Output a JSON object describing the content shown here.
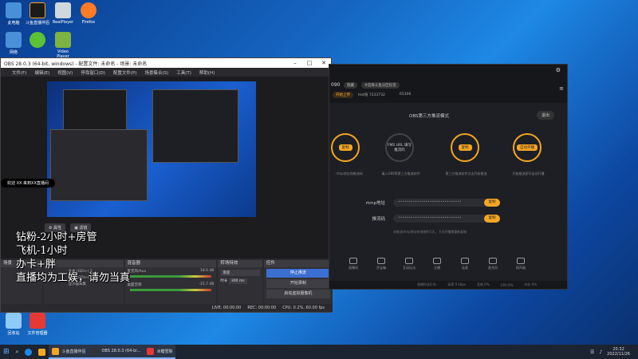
{
  "desktop": {
    "icons": [
      {
        "label": "此电脑",
        "color": "#4a90d9"
      },
      {
        "label": "斗鱼直播伴侣",
        "color": "#1b1b1b"
      },
      {
        "label": "RealPlayer",
        "color": "#cfd8dc"
      },
      {
        "label": "Firefox",
        "color": "#ff7b26"
      },
      {
        "label": "网络",
        "color": "#4a90d9"
      },
      {
        "label": "",
        "color": "#5bc236"
      },
      {
        "label": "Video Player",
        "color": "#7cb342"
      },
      {
        "label": "回收站",
        "color": "#90caf9"
      },
      {
        "label": "文件管理器",
        "color": "#e53935"
      }
    ]
  },
  "obs": {
    "title": "OBS 28.0.3 (64-bit, windows) - 配置文件: 未命名 - 场景: 未命名",
    "menu": [
      "文件(F)",
      "编辑(E)",
      "视图(V)",
      "停靠窗口(D)",
      "配置文件(P)",
      "场景集合(S)",
      "工具(T)",
      "帮助(H)"
    ],
    "preview_caption": "欢迎 XX 来到XX直播间",
    "toolbar": [
      "属性",
      "滤镜"
    ],
    "docks": {
      "scenes": "场景",
      "sources": "来源",
      "source_items": [
        "文本 (GDI+) 2",
        "文本 (GDI+)",
        "显示器采集"
      ],
      "mixer": "混音器",
      "mixer_tracks": [
        {
          "name": "麦克风/Aux",
          "db": "18.0 dB"
        },
        {
          "name": "桌面音频",
          "db": "-15.7 dB"
        }
      ],
      "transitions": "转场特效",
      "transition_value": "渐变",
      "duration_label": "时长",
      "duration_value": "300 ms",
      "controls": "控件",
      "control_buttons": [
        "停止推流",
        "开始录制",
        "启动虚拟摄像机",
        "工作室模式",
        "设置",
        "退出"
      ]
    },
    "status": {
      "live": "LIVE: 00:00:00",
      "rec": "REC: 00:00:00",
      "cpu": "CPU: 0.2%, 60.00 fps"
    }
  },
  "overlay": {
    "lines": [
      "钻粉-2小时+房管",
      "飞机-1小时",
      "办卡+胖",
      "直播均为工娱，请勿当真"
    ]
  },
  "tool": {
    "room": "090",
    "badge": "#选择斗鱼分区标签",
    "tab": "开始上传",
    "level": "Hot值 7233732",
    "followers": "65306",
    "mode_title": "OBS第三方推流模式",
    "exit": "退出",
    "steps": [
      {
        "n": "1",
        "btn": "复制",
        "desc": "rtmp地址和推流码"
      },
      {
        "n": "",
        "btn": "FMS URL\n填写推流码",
        "desc": "填入OBS等第三方推流软件"
      },
      {
        "n": "3",
        "btn": "复制",
        "desc": "第三方推流软件点击开始推流"
      },
      {
        "n": "4",
        "btn": "自动开播",
        "desc": "开始推流即可自动开播"
      }
    ],
    "rtmp_label": "rtmp地址",
    "rtmp_value": "••••••••••••••••••••••••••••••",
    "key_label": "推流码",
    "key_value": "••••••••••••••••••••••••••••••",
    "copy": "复制",
    "hint": "未推流rtmp地址有效期约1天，下次开播需重新复制",
    "tools": [
      "直播间",
      "开宝箱",
      "互动玩法",
      "主播",
      "连麦",
      "麦克风",
      "扬声器"
    ],
    "footer": [
      "直播时长0.0s",
      "码率 0 kbps",
      "丢帧 0%",
      "CPU 0%",
      "内存 0%"
    ]
  },
  "taskbar": {
    "apps": [
      {
        "label": "斗鱼直播伴侣",
        "color": "#f5a623"
      },
      {
        "label": "OBS 28.0.3 (64-bi...",
        "color": "#333"
      },
      {
        "label": "冰糖雪梨",
        "color": "#e53935"
      }
    ],
    "time": "20:32",
    "date": "2022/11/26"
  }
}
